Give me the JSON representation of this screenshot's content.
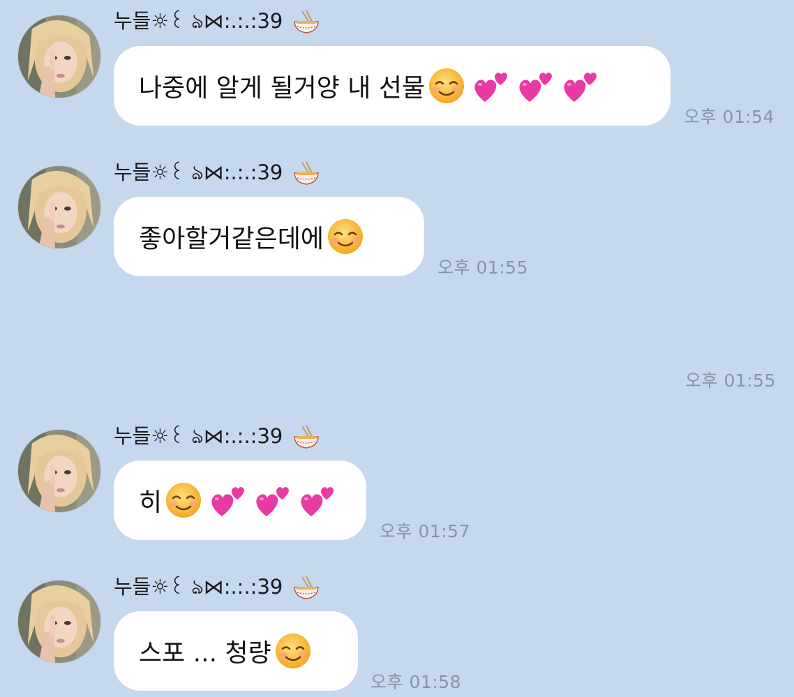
{
  "sender_name": "누들☼꒰ ঌ⋈:.:.:39",
  "messages": [
    {
      "text": "나중에 알게 될거양 내 선물",
      "emojis": [
        "smiling-face",
        "two-hearts",
        "two-hearts",
        "two-hearts"
      ],
      "time": "오후 01:54"
    },
    {
      "text": "좋아할거같은데에",
      "emojis": [
        "smiling-face"
      ],
      "time": "오후 01:55"
    },
    {
      "text": "히",
      "emojis": [
        "smiling-face",
        "two-hearts",
        "two-hearts",
        "two-hearts"
      ],
      "time": "오후 01:57"
    },
    {
      "text": "스포 ... 청량",
      "emojis": [
        "smiling-face"
      ],
      "time": "오후 01:58"
    }
  ],
  "standalone_time": "오후 01:55",
  "colors": {
    "background": "#c5d8ee",
    "bubble": "#ffffff",
    "time_text": "#8794a3"
  },
  "icons": {
    "sender_suffix": "noodle-bowl-icon",
    "smile": "smiling-face-emoji",
    "hearts": "two-hearts-emoji"
  }
}
